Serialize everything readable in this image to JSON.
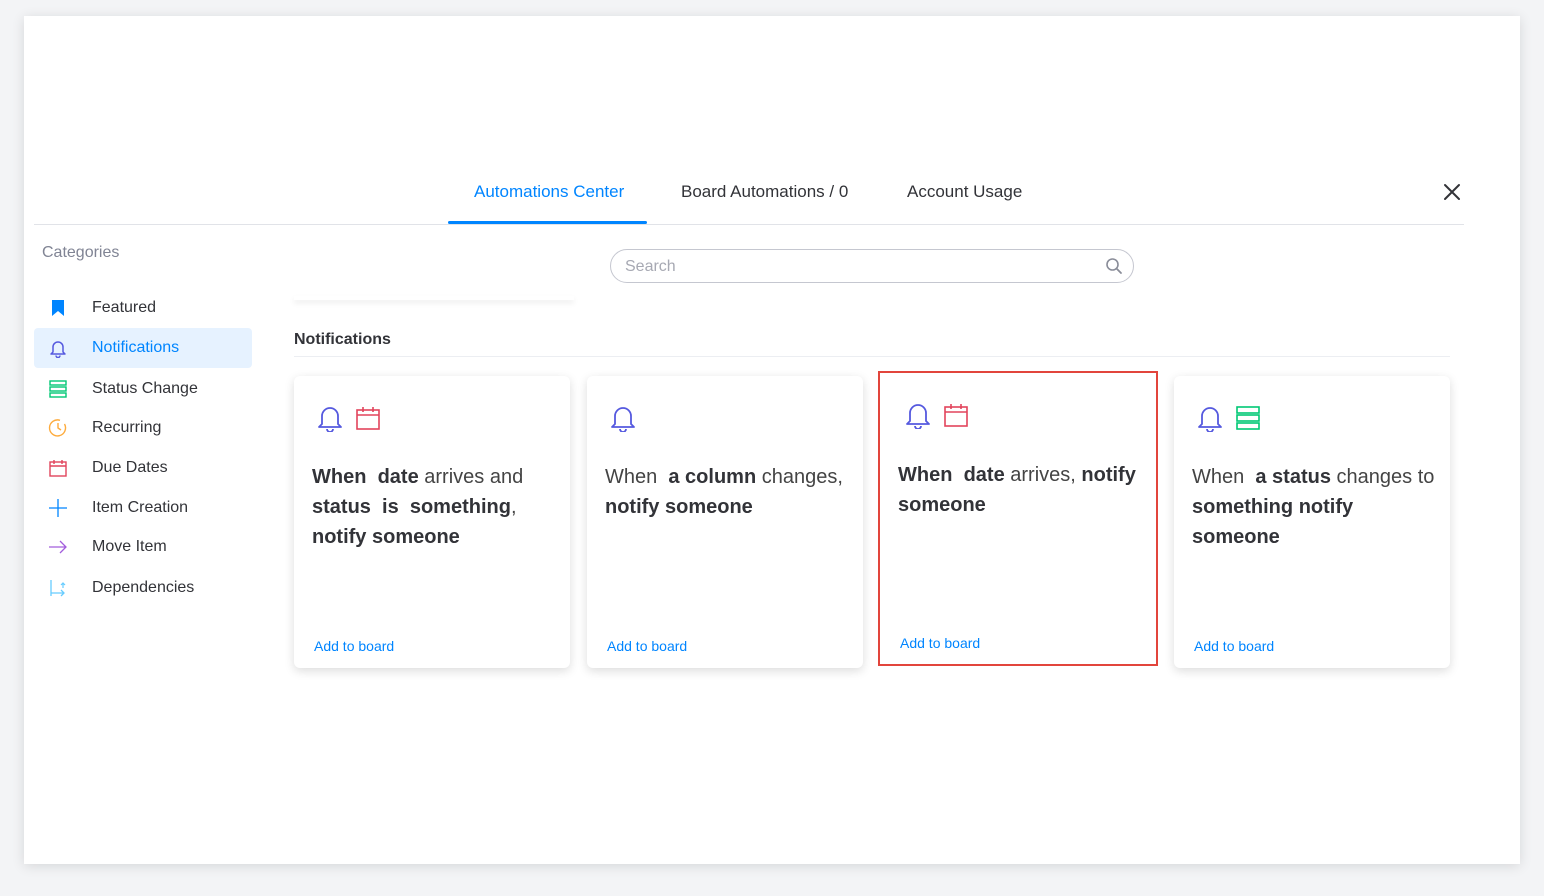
{
  "tabs": {
    "automations_center": "Automations Center",
    "board_automations": "Board Automations / 0",
    "account_usage": "Account Usage"
  },
  "sidebar": {
    "title": "Categories",
    "items": [
      {
        "label": "Featured",
        "icon": "bookmark-icon"
      },
      {
        "label": "Notifications",
        "icon": "bell-icon"
      },
      {
        "label": "Status Change",
        "icon": "status-icon"
      },
      {
        "label": "Recurring",
        "icon": "clock-icon"
      },
      {
        "label": "Due Dates",
        "icon": "calendar-icon"
      },
      {
        "label": "Item Creation",
        "icon": "plus-icon"
      },
      {
        "label": "Move Item",
        "icon": "arrow-right-icon"
      },
      {
        "label": "Dependencies",
        "icon": "dependency-icon"
      }
    ]
  },
  "search": {
    "placeholder": "Search"
  },
  "section": {
    "title": "Notifications"
  },
  "cards": [
    {
      "w1": "When",
      "w2": "date",
      "w3": "arrives and",
      "w4": "status",
      "w5": "is",
      "w6": "something",
      "w7": ",",
      "w8": "notify someone",
      "add": "Add to board"
    },
    {
      "w1": "When",
      "w2": "a column",
      "w3": "changes,",
      "w4": "notify someone",
      "add": "Add to board"
    },
    {
      "w1": "When",
      "w2": "date",
      "w3": "arrives,",
      "w4": "notify",
      "w5": "someone",
      "add": "Add to board"
    },
    {
      "w1": "When",
      "w2": "a status",
      "w3": "changes",
      "w4": "to",
      "w5": "something",
      "w6": "notify",
      "w7": "someone",
      "add": "Add to board"
    }
  ],
  "colors": {
    "accent": "#0085ff",
    "bell": "#5559df",
    "calendar": "#e2445c",
    "status": "#00c875",
    "recurring": "#fdab3d",
    "move": "#a25ddc",
    "dependency": "#66ccff",
    "highlight": "#e2453c"
  }
}
